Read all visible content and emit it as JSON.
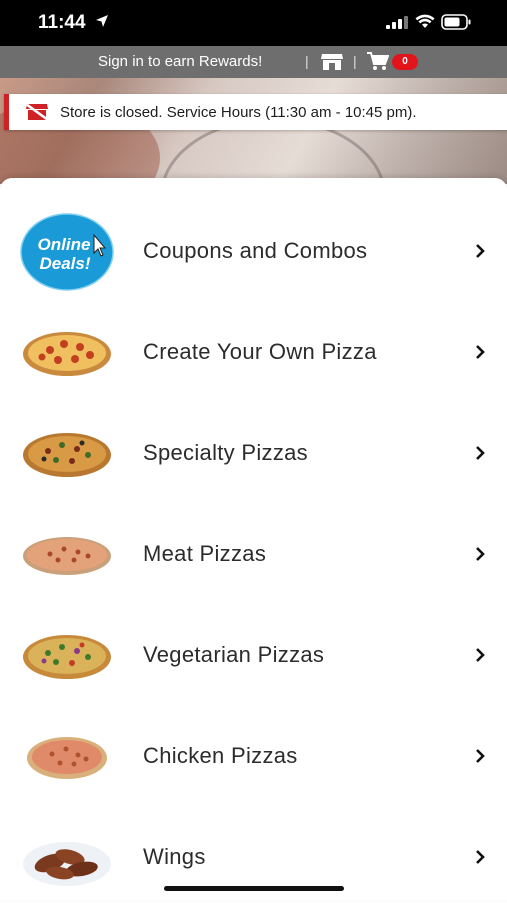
{
  "status_bar": {
    "time": "11:44"
  },
  "header": {
    "sign_in_text": "Sign in to earn Rewards!",
    "separator": "|",
    "cart_count": "0"
  },
  "banner": {
    "text": "Store is closed. Service Hours (11:30 am - 10:45 pm)."
  },
  "deals_badge": {
    "line1": "Online",
    "line2": "Deals!"
  },
  "menu": {
    "items": [
      {
        "label": "Coupons and Combos",
        "icon": "online-deals-badge"
      },
      {
        "label": "Create Your Own Pizza",
        "icon": "pepperoni-pizza-icon"
      },
      {
        "label": "Specialty Pizzas",
        "icon": "specialty-pizza-icon"
      },
      {
        "label": "Meat Pizzas",
        "icon": "meat-pizza-icon"
      },
      {
        "label": "Vegetarian Pizzas",
        "icon": "vegetarian-pizza-icon"
      },
      {
        "label": "Chicken Pizzas",
        "icon": "chicken-pizza-icon"
      },
      {
        "label": "Wings",
        "icon": "wings-icon"
      }
    ]
  },
  "colors": {
    "brand_red": "#cf2226",
    "header_gray": "#6e6e6e",
    "badge_red": "#e1141c",
    "deals_blue": "#1a9ad6"
  }
}
